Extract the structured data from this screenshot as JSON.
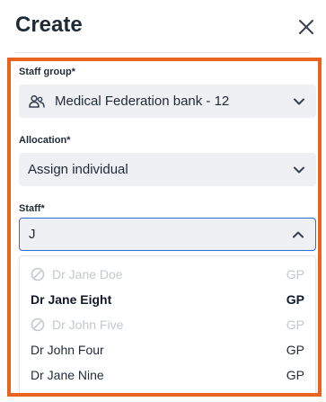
{
  "header": {
    "title": "Create"
  },
  "form": {
    "staff_group": {
      "label": "Staff group*",
      "value": "Medical Federation bank - 12",
      "icon": "people-icon"
    },
    "allocation": {
      "label": "Allocation*",
      "value": "Assign individual"
    },
    "staff": {
      "label": "Staff*",
      "value": "J"
    }
  },
  "options": [
    {
      "name": "Dr Jane Doe",
      "grade": "GP",
      "disabled": true
    },
    {
      "name": "Dr Jane Eight",
      "grade": "GP",
      "disabled": false,
      "highlighted": true
    },
    {
      "name": "Dr John Five",
      "grade": "GP",
      "disabled": true
    },
    {
      "name": "Dr John Four",
      "grade": "GP",
      "disabled": false
    },
    {
      "name": "Dr Jane Nine",
      "grade": "GP",
      "disabled": false
    }
  ],
  "colors": {
    "highlight_border": "#e8641e",
    "focus_border": "#2f6bd8",
    "field_bg": "#eef0f3"
  }
}
